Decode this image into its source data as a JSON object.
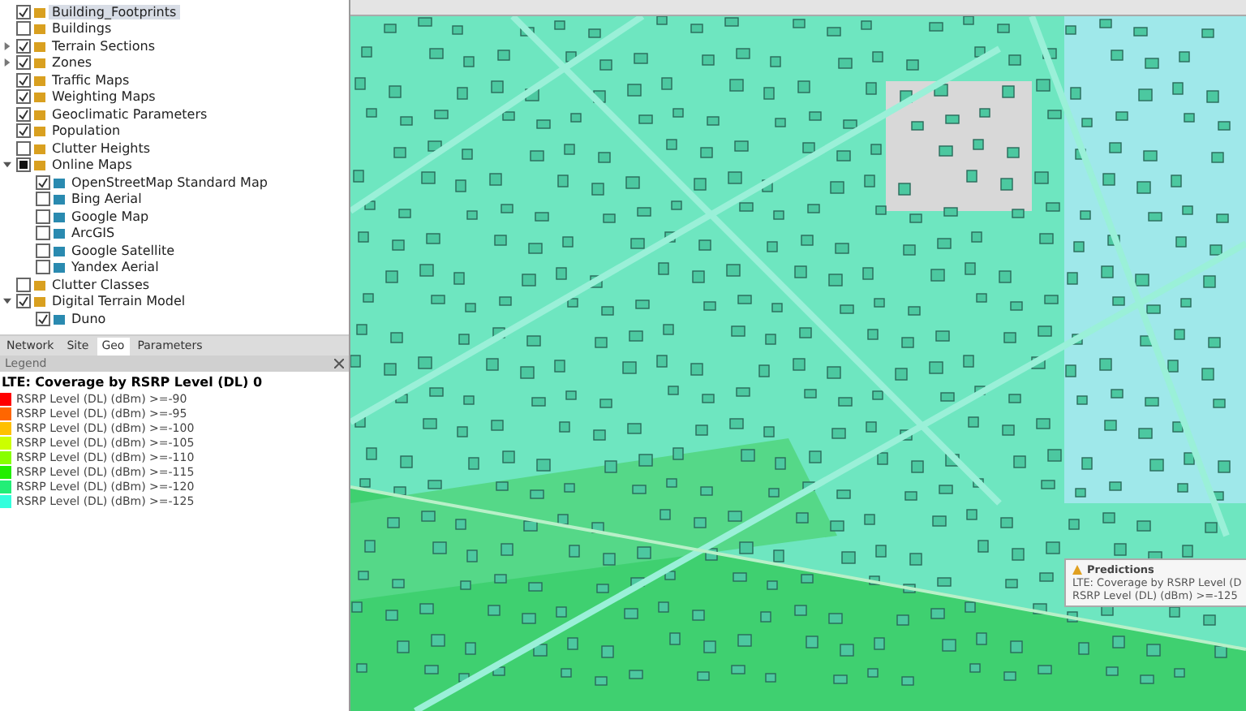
{
  "explorer": {
    "items": [
      {
        "label": "Building_Footprints",
        "checked": true,
        "selected": true
      },
      {
        "label": "Buildings",
        "checked": false,
        "selected": false
      },
      {
        "label": "Terrain Sections",
        "checked": true,
        "selected": false,
        "expanded": false
      },
      {
        "label": "Zones",
        "checked": true,
        "selected": false,
        "expanded": false
      },
      {
        "label": "Traffic Maps",
        "checked": true,
        "selected": false
      },
      {
        "label": "Weighting Maps",
        "checked": true,
        "selected": false
      },
      {
        "label": "Geoclimatic Parameters",
        "checked": true,
        "selected": false
      },
      {
        "label": "Population",
        "checked": true,
        "selected": false
      },
      {
        "label": "Clutter Heights",
        "checked": false,
        "selected": false
      },
      {
        "label": "Online Maps",
        "indeterminate": true,
        "selected": false,
        "expanded": true,
        "children": [
          {
            "label": "OpenStreetMap Standard Map",
            "checked": true,
            "selected": false
          },
          {
            "label": "Bing Aerial",
            "checked": false,
            "selected": false
          },
          {
            "label": "Google Map",
            "checked": false,
            "selected": false
          },
          {
            "label": "ArcGIS",
            "checked": false,
            "selected": false
          },
          {
            "label": "Google Satellite",
            "checked": false,
            "selected": false
          },
          {
            "label": "Yandex Aerial",
            "checked": false,
            "selected": false
          }
        ]
      },
      {
        "label": "Clutter Classes",
        "checked": false,
        "selected": false
      },
      {
        "label": "Digital Terrain Model",
        "checked": true,
        "selected": false,
        "expanded": true,
        "children": [
          {
            "label": "Duno",
            "checked": true,
            "selected": false
          }
        ]
      }
    ]
  },
  "tabs": [
    {
      "label": "Network",
      "selected": false
    },
    {
      "label": "Site",
      "selected": false
    },
    {
      "label": "Geo",
      "selected": true
    },
    {
      "label": "Parameters",
      "selected": false
    }
  ],
  "legend": {
    "title": "Legend",
    "heading": "LTE: Coverage by RSRP Level (DL) 0",
    "entries": [
      {
        "label": "RSRP Level (DL) (dBm) >=-90",
        "color": "#ff0000"
      },
      {
        "label": "RSRP Level (DL) (dBm) >=-95",
        "color": "#ff6600"
      },
      {
        "label": "RSRP Level (DL) (dBm) >=-100",
        "color": "#ffc000"
      },
      {
        "label": "RSRP Level (DL) (dBm) >=-105",
        "color": "#ccff00"
      },
      {
        "label": "RSRP Level (DL) (dBm) >=-110",
        "color": "#88ff00"
      },
      {
        "label": "RSRP Level (DL) (dBm) >=-115",
        "color": "#22ee00"
      },
      {
        "label": "RSRP Level (DL) (dBm) >=-120",
        "color": "#22ee77"
      },
      {
        "label": "RSRP Level (DL) (dBm) >=-125",
        "color": "#33ffdd"
      }
    ]
  },
  "tooltip": {
    "title": "Predictions",
    "lines": [
      "LTE: Coverage by RSRP Level (D",
      "RSRP Level (DL) (dBm) >=-125"
    ]
  }
}
